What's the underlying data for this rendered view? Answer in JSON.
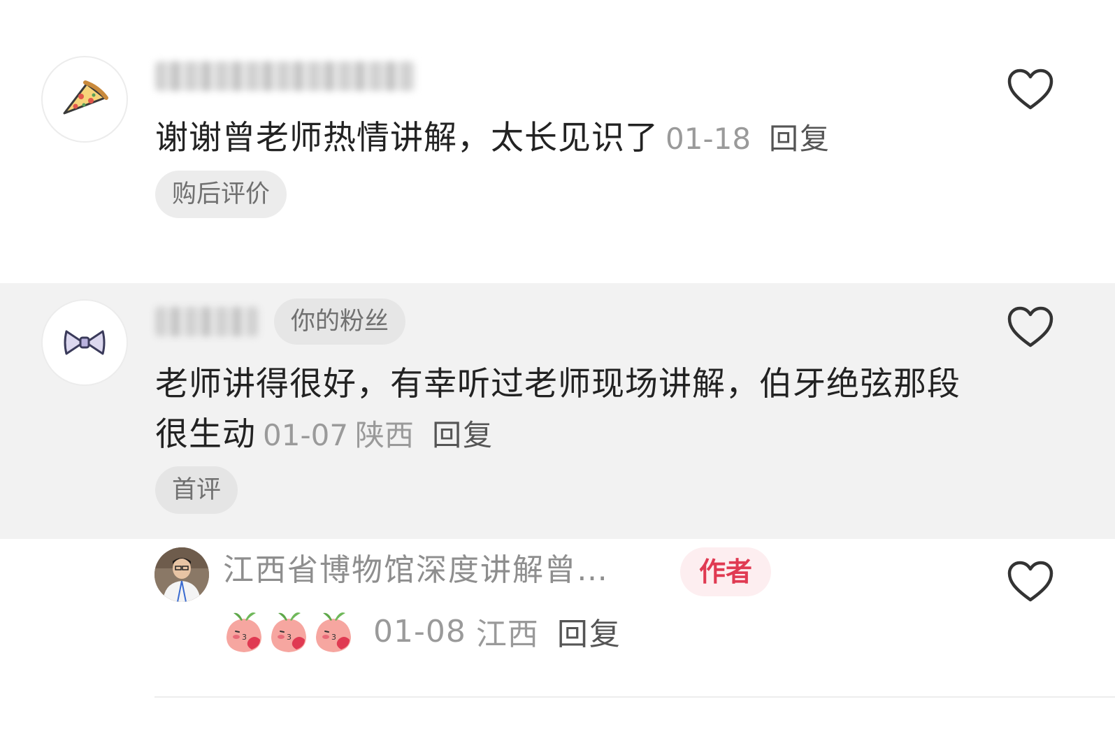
{
  "comments": [
    {
      "avatar_icon": "pizza-slice-icon",
      "text": "谢谢曾老师热情讲解，太长见识了",
      "date": "01-18",
      "location": "",
      "reply_label": "回复",
      "tag": "购后评价"
    },
    {
      "avatar_icon": "bow-tie-icon",
      "badge": "你的粉丝",
      "text": "老师讲得很好，有幸听过老师现场讲解，伯牙绝弦那段很生动",
      "date": "01-07",
      "location": "陕西",
      "reply_label": "回复",
      "tag": "首评"
    }
  ],
  "author_reply": {
    "name": "江西省博物馆深度讲解曾…",
    "badge": "作者",
    "emojis": [
      "peach-kiss-emoji",
      "peach-kiss-emoji",
      "peach-kiss-emoji"
    ],
    "date": "01-08",
    "location": "江西",
    "reply_label": "回复"
  },
  "colors": {
    "author_badge_bg": "#fdeef0",
    "author_badge_text": "#e03a52",
    "highlight_bg": "#f2f2f2"
  }
}
